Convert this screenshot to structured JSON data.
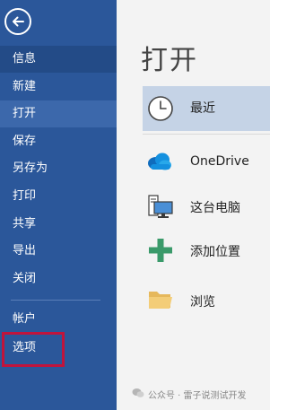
{
  "sidebar": {
    "items": [
      {
        "label": "信息"
      },
      {
        "label": "新建"
      },
      {
        "label": "打开"
      },
      {
        "label": "保存"
      },
      {
        "label": "另存为"
      },
      {
        "label": "打印"
      },
      {
        "label": "共享"
      },
      {
        "label": "导出"
      },
      {
        "label": "关闭"
      },
      {
        "label": "帐户"
      },
      {
        "label": "选项"
      }
    ]
  },
  "main": {
    "title": "打开",
    "locations": [
      {
        "label": "最近"
      },
      {
        "label": "OneDrive"
      },
      {
        "label": "这台电脑"
      },
      {
        "label": "添加位置"
      },
      {
        "label": "浏览"
      }
    ]
  },
  "watermark": {
    "text": "公众号 · 雷子说测试开发"
  },
  "colors": {
    "sidebar": "#2b579a",
    "selected": "#c5d3e6",
    "highlight": "#c0143c"
  }
}
